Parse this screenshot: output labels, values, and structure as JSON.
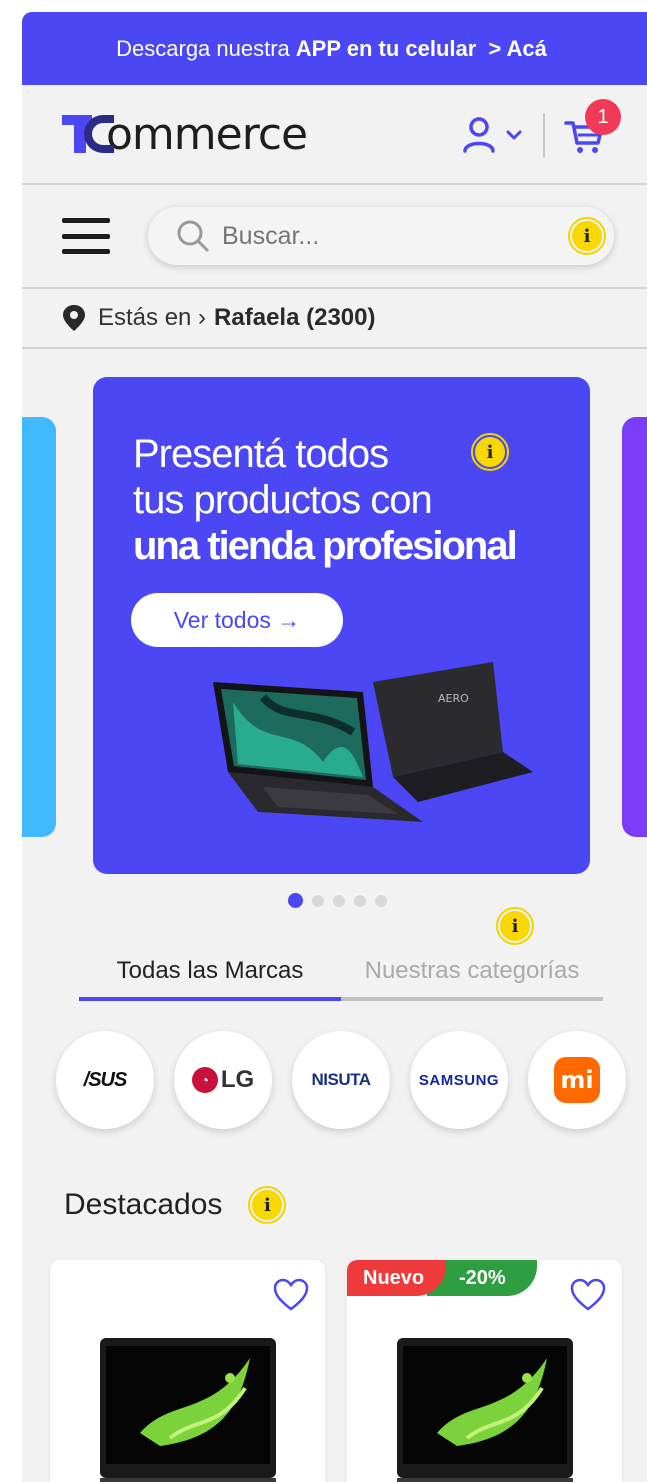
{
  "promo_bar": {
    "prefix": "Descarga nuestra",
    "bold": "APP en tu celular",
    "link": "> Acá"
  },
  "header": {
    "logo_text": "ommerce",
    "cart_count": "1"
  },
  "search": {
    "placeholder": "Buscar..."
  },
  "location": {
    "label": "Estás en ›",
    "city": "Rafaela (2300)"
  },
  "banner": {
    "line1": "Presentá todos",
    "line2": "tus productos con",
    "line3": "una tienda profesional",
    "button": "Ver todos →",
    "laptop_brand": "AERO"
  },
  "tabs": [
    {
      "label": "Todas las Marcas",
      "active": true
    },
    {
      "label": "Nuestras categorías",
      "active": false
    }
  ],
  "brands": [
    {
      "name": "ASUS",
      "text": "/SUS"
    },
    {
      "name": "LG",
      "text": "LG"
    },
    {
      "name": "NISUTA",
      "text": "NISUTA"
    },
    {
      "name": "SAMSUNG",
      "text": "SAMSUNG"
    },
    {
      "name": "Xiaomi",
      "text": "mi"
    }
  ],
  "featured": {
    "title": "Destacados",
    "products": [
      {
        "badges": []
      },
      {
        "badges": [
          "Nuevo",
          "-20%"
        ]
      }
    ]
  },
  "colors": {
    "primary": "#4b47f5",
    "info": "#f7d800",
    "badge_red": "#ee3a3a",
    "badge_green": "#2f9e41"
  }
}
